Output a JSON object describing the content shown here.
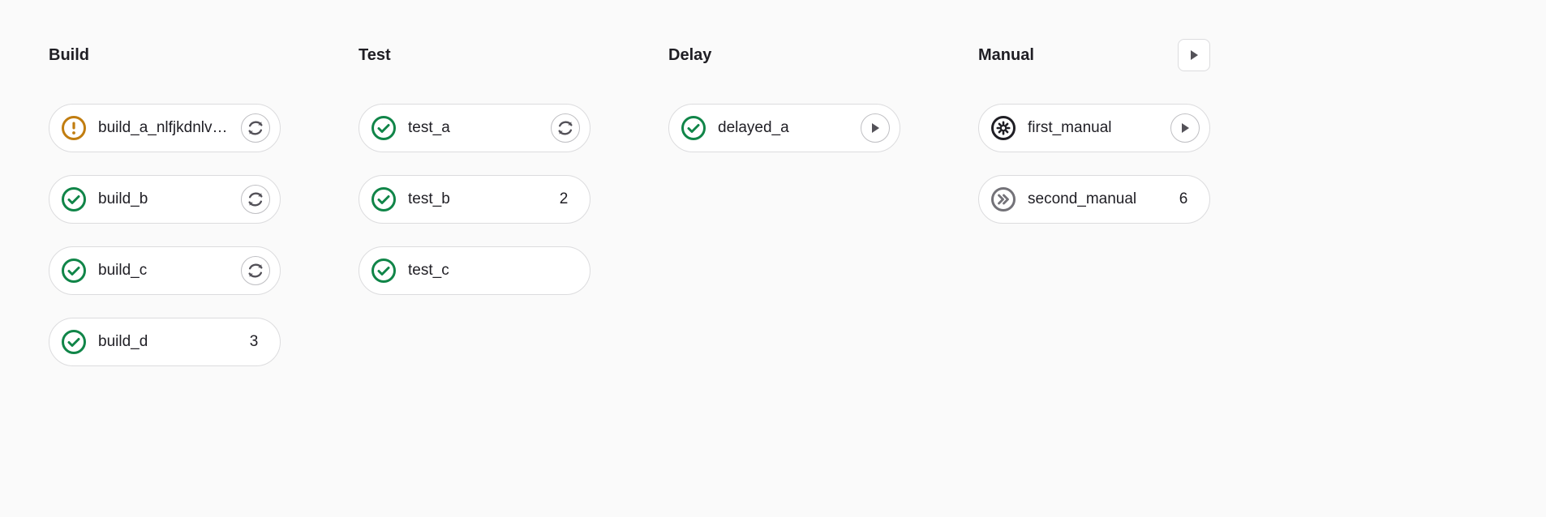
{
  "stages": [
    {
      "name": "Build",
      "action": null,
      "jobs": [
        {
          "status": "warning",
          "label": "build_a_nlfjkdnlvskfnkjdhf",
          "trailing": "retry"
        },
        {
          "status": "success",
          "label": "build_b",
          "trailing": "retry"
        },
        {
          "status": "success",
          "label": "build_c",
          "trailing": "retry"
        },
        {
          "status": "success",
          "label": "build_d",
          "trailing_count": 3
        }
      ]
    },
    {
      "name": "Test",
      "action": null,
      "jobs": [
        {
          "status": "success",
          "label": "test_a",
          "trailing": "retry"
        },
        {
          "status": "success",
          "label": "test_b",
          "trailing_count": 2
        },
        {
          "status": "success",
          "label": "test_c"
        }
      ]
    },
    {
      "name": "Delay",
      "action": null,
      "jobs": [
        {
          "status": "success",
          "label": "delayed_a",
          "trailing": "play"
        }
      ]
    },
    {
      "name": "Manual",
      "action": "play",
      "jobs": [
        {
          "status": "manual",
          "label": "first_manual",
          "trailing": "play"
        },
        {
          "status": "skipped",
          "label": "second_manual",
          "trailing_count": 6
        }
      ]
    }
  ],
  "colors": {
    "success": "#108548",
    "warning": "#c17d10",
    "neutral": "#737278",
    "dark": "#1f1e24"
  }
}
